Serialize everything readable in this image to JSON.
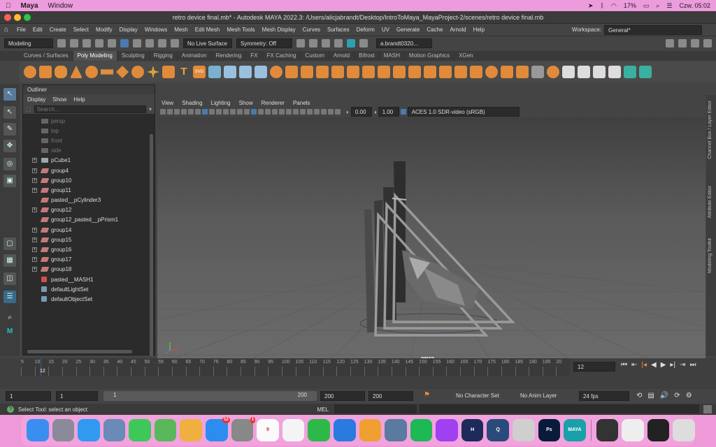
{
  "macos_menubar": {
    "app_name": "Maya",
    "menu_window": "Window",
    "battery": "17%",
    "clock": "Czw. 05:02"
  },
  "window": {
    "title": "retro device final.mb* - Autodesk MAYA 2022.3: /Users/alicjabrandt/Desktop/IntroToMaya_MayaProject-2/scenes/retro device final.mb"
  },
  "main_menu": [
    "File",
    "Edit",
    "Create",
    "Select",
    "Modify",
    "Display",
    "Windows",
    "Mesh",
    "Edit Mesh",
    "Mesh Tools",
    "Mesh Display",
    "Curves",
    "Surfaces",
    "Deform",
    "UV",
    "Generate",
    "Cache",
    "Arnold",
    "Help"
  ],
  "workspace": {
    "label": "Workspace:",
    "value": "General*"
  },
  "status_line": {
    "mode": "Modeling",
    "live_surface": "No Live Surface",
    "symmetry": "Symmetry: Off",
    "user": "a.brandt0320..."
  },
  "shelf_tabs": [
    "Curves / Surfaces",
    "Poly Modeling",
    "Sculpting",
    "Rigging",
    "Animation",
    "Rendering",
    "FX",
    "FX Caching",
    "Custom",
    "Arnold",
    "Bifrost",
    "MASH",
    "Motion Graphics",
    "XGen"
  ],
  "shelf_active": "Poly Modeling",
  "shelf_text_icons": {
    "text": "T",
    "svg": "SVG"
  },
  "outliner": {
    "title": "Outliner",
    "menu": [
      "Display",
      "Show",
      "Help"
    ],
    "search_placeholder": "Search...",
    "items": [
      {
        "label": "persp",
        "type": "camera",
        "dim": true,
        "expand": false
      },
      {
        "label": "top",
        "type": "camera",
        "dim": true,
        "expand": false
      },
      {
        "label": "front",
        "type": "camera",
        "dim": true,
        "expand": false
      },
      {
        "label": "side",
        "type": "camera",
        "dim": true,
        "expand": false
      },
      {
        "label": "pCube1",
        "type": "mesh",
        "dim": false,
        "expand": true
      },
      {
        "label": "group4",
        "type": "group",
        "dim": false,
        "expand": true
      },
      {
        "label": "group10",
        "type": "group",
        "dim": false,
        "expand": true
      },
      {
        "label": "group11",
        "type": "group",
        "dim": false,
        "expand": true
      },
      {
        "label": "pasted__pCylinder3",
        "type": "group",
        "dim": false,
        "expand": false
      },
      {
        "label": "group12",
        "type": "group",
        "dim": false,
        "expand": true
      },
      {
        "label": "group12_pasted__pPrism1",
        "type": "group",
        "dim": false,
        "expand": false
      },
      {
        "label": "group14",
        "type": "group",
        "dim": false,
        "expand": true
      },
      {
        "label": "group15",
        "type": "group",
        "dim": false,
        "expand": true
      },
      {
        "label": "group16",
        "type": "group",
        "dim": false,
        "expand": true
      },
      {
        "label": "group17",
        "type": "group",
        "dim": false,
        "expand": true
      },
      {
        "label": "group18",
        "type": "group",
        "dim": false,
        "expand": true
      },
      {
        "label": "pasted__MASH1",
        "type": "mash",
        "dim": false,
        "expand": false
      },
      {
        "label": "defaultLightSet",
        "type": "set",
        "dim": false,
        "expand": false
      },
      {
        "label": "defaultObjectSet",
        "type": "set",
        "dim": false,
        "expand": false
      }
    ]
  },
  "viewport": {
    "menu": [
      "View",
      "Shading",
      "Lighting",
      "Show",
      "Renderer",
      "Panels"
    ],
    "exposure": "0.00",
    "gamma": "1.00",
    "color_space": "ACES 1.0 SDR-video (sRGB)",
    "camera_label": "persp"
  },
  "side_tabs": [
    "Channel Box / Layer Editor",
    "Attribute Editor",
    "Modeling Toolkit"
  ],
  "timeline": {
    "ticks": [
      "5",
      "10",
      "15",
      "20",
      "25",
      "30",
      "35",
      "40",
      "45",
      "50",
      "55",
      "60",
      "65",
      "70",
      "75",
      "80",
      "85",
      "90",
      "95",
      "100",
      "105",
      "110",
      "115",
      "120",
      "125",
      "130",
      "135",
      "140",
      "145",
      "150",
      "155",
      "160",
      "165",
      "170",
      "175",
      "180",
      "185",
      "190",
      "195",
      "20"
    ],
    "current_frame": "12",
    "current_frame_field": "12"
  },
  "range": {
    "start": "1",
    "playback_start": "1",
    "slider_start": "1",
    "slider_end": "200",
    "playback_end": "200",
    "end": "200",
    "character_set": "No Character Set",
    "anim_layer": "No Anim Layer",
    "fps": "24 fps"
  },
  "help_line": {
    "text": "Select Tool: select an object",
    "mel_label": "MEL"
  },
  "dock": {
    "apps": [
      {
        "name": "finder",
        "color": "#3a8ef0",
        "label": ""
      },
      {
        "name": "launchpad",
        "color": "#8a8a9a",
        "label": ""
      },
      {
        "name": "safari",
        "color": "#2f9af0",
        "label": ""
      },
      {
        "name": "preview",
        "color": "#6a8ab8",
        "label": ""
      },
      {
        "name": "messages",
        "color": "#3fc85a",
        "label": ""
      },
      {
        "name": "maps",
        "color": "#58b85a",
        "label": ""
      },
      {
        "name": "photos",
        "color": "#f0b040",
        "label": ""
      },
      {
        "name": "app-store",
        "color": "#2d8cf0",
        "label": "",
        "badge": "12"
      },
      {
        "name": "system-preferences",
        "color": "#888",
        "label": "",
        "badge": "1"
      },
      {
        "name": "calendar",
        "color": "#fafafa",
        "label": "9"
      },
      {
        "name": "reminders",
        "color": "#f4f4f4",
        "label": ""
      },
      {
        "name": "numbers",
        "color": "#2fb84a",
        "label": ""
      },
      {
        "name": "keynote",
        "color": "#2a7ae0",
        "label": ""
      },
      {
        "name": "pages",
        "color": "#f0a030",
        "label": ""
      },
      {
        "name": "image-capture",
        "color": "#5a7aa0",
        "label": ""
      },
      {
        "name": "spotify",
        "color": "#1db954",
        "label": ""
      },
      {
        "name": "messenger",
        "color": "#a040f0",
        "label": ""
      },
      {
        "name": "houdini",
        "color": "#1e2a5a",
        "label": "H"
      },
      {
        "name": "quicktime",
        "color": "#2a4a7a",
        "label": "Q"
      },
      {
        "name": "zbrush",
        "color": "#cfcfcf",
        "label": ""
      },
      {
        "name": "photoshop",
        "color": "#0a1a3a",
        "label": "Ps"
      },
      {
        "name": "maya",
        "color": "#1aa0a8",
        "label": "MAYA"
      },
      {
        "name": "screenshot-1",
        "color": "#333",
        "label": ""
      },
      {
        "name": "screenshot-2",
        "color": "#eee",
        "label": ""
      },
      {
        "name": "screenshot-3",
        "color": "#222",
        "label": ""
      },
      {
        "name": "trash",
        "color": "#ddd",
        "label": ""
      }
    ]
  }
}
